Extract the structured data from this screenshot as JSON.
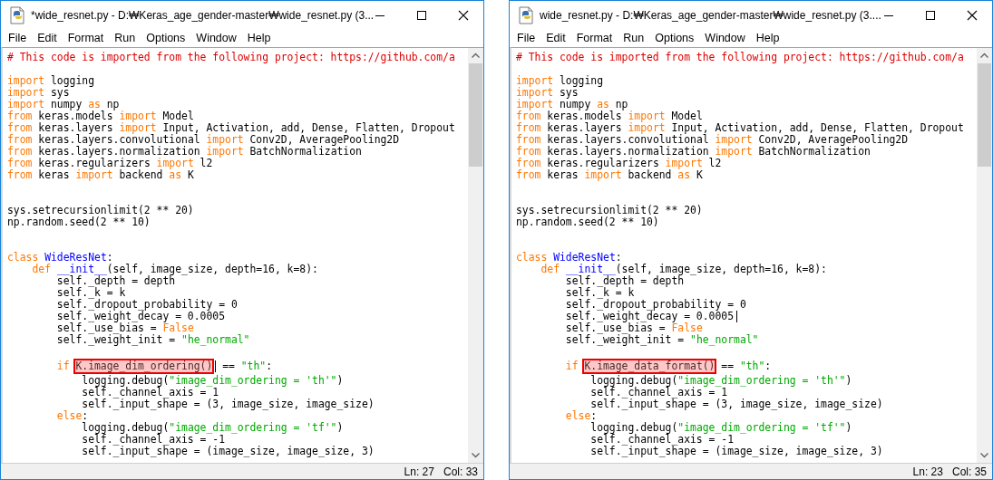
{
  "windows": [
    {
      "title": "*wide_resnet.py - D:₩Keras_age_gender-master₩wide_resnet.py (3...",
      "menu": [
        "File",
        "Edit",
        "Format",
        "Run",
        "Options",
        "Window",
        "Help"
      ],
      "lines": [
        {
          "kind": "code",
          "segments": [
            {
              "t": "# This code is imported from the following project: https://github.com/a",
              "kind": "comment"
            }
          ]
        },
        {
          "kind": "blank"
        },
        {
          "kind": "code",
          "segments": [
            {
              "t": "import",
              "kind": "keyword"
            },
            {
              "t": " logging",
              "kind": "plain"
            }
          ]
        },
        {
          "kind": "code",
          "segments": [
            {
              "t": "import",
              "kind": "keyword"
            },
            {
              "t": " sys",
              "kind": "plain"
            }
          ]
        },
        {
          "kind": "code",
          "segments": [
            {
              "t": "import",
              "kind": "keyword"
            },
            {
              "t": " numpy ",
              "kind": "plain"
            },
            {
              "t": "as",
              "kind": "keyword"
            },
            {
              "t": " np",
              "kind": "plain"
            }
          ]
        },
        {
          "kind": "code",
          "segments": [
            {
              "t": "from",
              "kind": "keyword"
            },
            {
              "t": " keras.models ",
              "kind": "plain"
            },
            {
              "t": "import",
              "kind": "keyword"
            },
            {
              "t": " Model",
              "kind": "plain"
            }
          ]
        },
        {
          "kind": "code",
          "segments": [
            {
              "t": "from",
              "kind": "keyword"
            },
            {
              "t": " keras.layers ",
              "kind": "plain"
            },
            {
              "t": "import",
              "kind": "keyword"
            },
            {
              "t": " Input, Activation, add, Dense, Flatten, Dropout",
              "kind": "plain"
            }
          ]
        },
        {
          "kind": "code",
          "segments": [
            {
              "t": "from",
              "kind": "keyword"
            },
            {
              "t": " keras.layers.convolutional ",
              "kind": "plain"
            },
            {
              "t": "import",
              "kind": "keyword"
            },
            {
              "t": " Conv2D, AveragePooling2D",
              "kind": "plain"
            }
          ]
        },
        {
          "kind": "code",
          "segments": [
            {
              "t": "from",
              "kind": "keyword"
            },
            {
              "t": " keras.layers.normalization ",
              "kind": "plain"
            },
            {
              "t": "import",
              "kind": "keyword"
            },
            {
              "t": " BatchNormalization",
              "kind": "plain"
            }
          ]
        },
        {
          "kind": "code",
          "segments": [
            {
              "t": "from",
              "kind": "keyword"
            },
            {
              "t": " keras.regularizers ",
              "kind": "plain"
            },
            {
              "t": "import",
              "kind": "keyword"
            },
            {
              "t": " l2",
              "kind": "plain"
            }
          ]
        },
        {
          "kind": "code",
          "segments": [
            {
              "t": "from",
              "kind": "keyword"
            },
            {
              "t": " keras ",
              "kind": "plain"
            },
            {
              "t": "import",
              "kind": "keyword"
            },
            {
              "t": " backend ",
              "kind": "plain"
            },
            {
              "t": "as",
              "kind": "keyword"
            },
            {
              "t": " K",
              "kind": "plain"
            }
          ]
        },
        {
          "kind": "blank"
        },
        {
          "kind": "blank"
        },
        {
          "kind": "code",
          "segments": [
            {
              "t": "sys.setrecursionlimit(2 ** 20)",
              "kind": "plain"
            }
          ]
        },
        {
          "kind": "code",
          "segments": [
            {
              "t": "np.random.seed(2 ** 10)",
              "kind": "plain"
            }
          ]
        },
        {
          "kind": "blank"
        },
        {
          "kind": "blank"
        },
        {
          "kind": "code",
          "segments": [
            {
              "t": "class ",
              "kind": "keyword"
            },
            {
              "t": "WideResNet",
              "kind": "definition"
            },
            {
              "t": ":",
              "kind": "plain"
            }
          ]
        },
        {
          "kind": "code",
          "segments": [
            {
              "t": "    def ",
              "kind": "keyword"
            },
            {
              "t": "__init__",
              "kind": "definition"
            },
            {
              "t": "(self, image_size, depth=16, k=8):",
              "kind": "plain"
            }
          ]
        },
        {
          "kind": "code",
          "segments": [
            {
              "t": "        self._depth = depth",
              "kind": "plain"
            }
          ]
        },
        {
          "kind": "code",
          "segments": [
            {
              "t": "        self._k = k",
              "kind": "plain"
            }
          ]
        },
        {
          "kind": "code",
          "segments": [
            {
              "t": "        self._dropout_probability = 0",
              "kind": "plain"
            }
          ]
        },
        {
          "kind": "code",
          "segments": [
            {
              "t": "        self._weight_decay = 0.0005",
              "kind": "plain"
            }
          ]
        },
        {
          "kind": "code",
          "segments": [
            {
              "t": "        self._use_bias = ",
              "kind": "plain"
            },
            {
              "t": "False",
              "kind": "keyword"
            }
          ]
        },
        {
          "kind": "code",
          "segments": [
            {
              "t": "        self._weight_init = ",
              "kind": "plain"
            },
            {
              "t": "\"he_normal\"",
              "kind": "string"
            }
          ]
        },
        {
          "kind": "blank"
        },
        {
          "kind": "code",
          "segments": [
            {
              "t": "        if ",
              "kind": "keyword"
            },
            {
              "t": "K.image_dim_ordering()",
              "kind": "selection",
              "boxed": true,
              "caret": true
            },
            {
              "t": " == ",
              "kind": "plain"
            },
            {
              "t": "\"th\"",
              "kind": "string"
            },
            {
              "t": ":",
              "kind": "plain"
            }
          ]
        },
        {
          "kind": "code",
          "segments": [
            {
              "t": "            logging.debug(",
              "kind": "plain"
            },
            {
              "t": "\"image_dim_ordering = 'th'\"",
              "kind": "string"
            },
            {
              "t": ")",
              "kind": "plain"
            }
          ]
        },
        {
          "kind": "code",
          "segments": [
            {
              "t": "            self._channel_axis = 1",
              "kind": "plain"
            }
          ]
        },
        {
          "kind": "code",
          "segments": [
            {
              "t": "            self._input_shape = (3, image_size, image_size)",
              "kind": "plain"
            }
          ]
        },
        {
          "kind": "code",
          "segments": [
            {
              "t": "        else",
              "kind": "keyword"
            },
            {
              "t": ":",
              "kind": "plain"
            }
          ]
        },
        {
          "kind": "code",
          "segments": [
            {
              "t": "            logging.debug(",
              "kind": "plain"
            },
            {
              "t": "\"image_dim_ordering = 'tf'\"",
              "kind": "string"
            },
            {
              "t": ")",
              "kind": "plain"
            }
          ]
        },
        {
          "kind": "code",
          "segments": [
            {
              "t": "            self._channel_axis = -1",
              "kind": "plain"
            }
          ]
        },
        {
          "kind": "code",
          "segments": [
            {
              "t": "            self._input_shape = (image_size, image_size, 3)",
              "kind": "plain"
            }
          ]
        }
      ],
      "status": [
        "Ln: 27",
        "Col: 33"
      ]
    },
    {
      "title": "wide_resnet.py - D:₩Keras_age_gender-master₩wide_resnet.py (3....",
      "menu": [
        "File",
        "Edit",
        "Format",
        "Run",
        "Options",
        "Window",
        "Help"
      ],
      "lines": [
        {
          "kind": "code",
          "segments": [
            {
              "t": "# This code is imported from the following project: https://github.com/a",
              "kind": "comment"
            }
          ]
        },
        {
          "kind": "blank"
        },
        {
          "kind": "code",
          "segments": [
            {
              "t": "import",
              "kind": "keyword"
            },
            {
              "t": " logging",
              "kind": "plain"
            }
          ]
        },
        {
          "kind": "code",
          "segments": [
            {
              "t": "import",
              "kind": "keyword"
            },
            {
              "t": " sys",
              "kind": "plain"
            }
          ]
        },
        {
          "kind": "code",
          "segments": [
            {
              "t": "import",
              "kind": "keyword"
            },
            {
              "t": " numpy ",
              "kind": "plain"
            },
            {
              "t": "as",
              "kind": "keyword"
            },
            {
              "t": " np",
              "kind": "plain"
            }
          ]
        },
        {
          "kind": "code",
          "segments": [
            {
              "t": "from",
              "kind": "keyword"
            },
            {
              "t": " keras.models ",
              "kind": "plain"
            },
            {
              "t": "import",
              "kind": "keyword"
            },
            {
              "t": " Model",
              "kind": "plain"
            }
          ]
        },
        {
          "kind": "code",
          "segments": [
            {
              "t": "from",
              "kind": "keyword"
            },
            {
              "t": " keras.layers ",
              "kind": "plain"
            },
            {
              "t": "import",
              "kind": "keyword"
            },
            {
              "t": " Input, Activation, add, Dense, Flatten, Dropout",
              "kind": "plain"
            }
          ]
        },
        {
          "kind": "code",
          "segments": [
            {
              "t": "from",
              "kind": "keyword"
            },
            {
              "t": " keras.layers.convolutional ",
              "kind": "plain"
            },
            {
              "t": "import",
              "kind": "keyword"
            },
            {
              "t": " Conv2D, AveragePooling2D",
              "kind": "plain"
            }
          ]
        },
        {
          "kind": "code",
          "segments": [
            {
              "t": "from",
              "kind": "keyword"
            },
            {
              "t": " keras.layers.normalization ",
              "kind": "plain"
            },
            {
              "t": "import",
              "kind": "keyword"
            },
            {
              "t": " BatchNormalization",
              "kind": "plain"
            }
          ]
        },
        {
          "kind": "code",
          "segments": [
            {
              "t": "from",
              "kind": "keyword"
            },
            {
              "t": " keras.regularizers ",
              "kind": "plain"
            },
            {
              "t": "import",
              "kind": "keyword"
            },
            {
              "t": " l2",
              "kind": "plain"
            }
          ]
        },
        {
          "kind": "code",
          "segments": [
            {
              "t": "from",
              "kind": "keyword"
            },
            {
              "t": " keras ",
              "kind": "plain"
            },
            {
              "t": "import",
              "kind": "keyword"
            },
            {
              "t": " backend ",
              "kind": "plain"
            },
            {
              "t": "as",
              "kind": "keyword"
            },
            {
              "t": " K",
              "kind": "plain"
            }
          ]
        },
        {
          "kind": "blank"
        },
        {
          "kind": "blank"
        },
        {
          "kind": "code",
          "segments": [
            {
              "t": "sys.setrecursionlimit(2 ** 20)",
              "kind": "plain"
            }
          ]
        },
        {
          "kind": "code",
          "segments": [
            {
              "t": "np.random.seed(2 ** 10)",
              "kind": "plain"
            }
          ]
        },
        {
          "kind": "blank"
        },
        {
          "kind": "blank"
        },
        {
          "kind": "code",
          "segments": [
            {
              "t": "class ",
              "kind": "keyword"
            },
            {
              "t": "WideResNet",
              "kind": "definition"
            },
            {
              "t": ":",
              "kind": "plain"
            }
          ]
        },
        {
          "kind": "code",
          "segments": [
            {
              "t": "    def ",
              "kind": "keyword"
            },
            {
              "t": "__init__",
              "kind": "definition"
            },
            {
              "t": "(self, image_size, depth=16, k=8):",
              "kind": "plain"
            }
          ]
        },
        {
          "kind": "code",
          "segments": [
            {
              "t": "        self._depth = depth",
              "kind": "plain"
            }
          ]
        },
        {
          "kind": "code",
          "segments": [
            {
              "t": "        self._k = k",
              "kind": "plain"
            }
          ]
        },
        {
          "kind": "code",
          "segments": [
            {
              "t": "        self._dropout_probability = 0",
              "kind": "plain"
            }
          ]
        },
        {
          "kind": "code",
          "segments": [
            {
              "t": "        self._weight_decay = 0.0005",
              "kind": "plain",
              "caret": true
            }
          ]
        },
        {
          "kind": "code",
          "segments": [
            {
              "t": "        self._use_bias = ",
              "kind": "plain"
            },
            {
              "t": "False",
              "kind": "keyword"
            }
          ]
        },
        {
          "kind": "code",
          "segments": [
            {
              "t": "        self._weight_init = ",
              "kind": "plain"
            },
            {
              "t": "\"he_normal\"",
              "kind": "string"
            }
          ]
        },
        {
          "kind": "blank"
        },
        {
          "kind": "code",
          "segments": [
            {
              "t": "        if ",
              "kind": "keyword"
            },
            {
              "t": "K.image_data_format()",
              "kind": "selection",
              "boxed": true
            },
            {
              "t": " == ",
              "kind": "plain"
            },
            {
              "t": "\"th\"",
              "kind": "string"
            },
            {
              "t": ":",
              "kind": "plain"
            }
          ]
        },
        {
          "kind": "code",
          "segments": [
            {
              "t": "            logging.debug(",
              "kind": "plain"
            },
            {
              "t": "\"image_dim_ordering = 'th'\"",
              "kind": "string"
            },
            {
              "t": ")",
              "kind": "plain"
            }
          ]
        },
        {
          "kind": "code",
          "segments": [
            {
              "t": "            self._channel_axis = 1",
              "kind": "plain"
            }
          ]
        },
        {
          "kind": "code",
          "segments": [
            {
              "t": "            self._input_shape = (3, image_size, image_size)",
              "kind": "plain"
            }
          ]
        },
        {
          "kind": "code",
          "segments": [
            {
              "t": "        else",
              "kind": "keyword"
            },
            {
              "t": ":",
              "kind": "plain"
            }
          ]
        },
        {
          "kind": "code",
          "segments": [
            {
              "t": "            logging.debug(",
              "kind": "plain"
            },
            {
              "t": "\"image_dim_ordering = 'tf'\"",
              "kind": "string"
            },
            {
              "t": ")",
              "kind": "plain"
            }
          ]
        },
        {
          "kind": "code",
          "segments": [
            {
              "t": "            self._channel_axis = -1",
              "kind": "plain"
            }
          ]
        },
        {
          "kind": "code",
          "segments": [
            {
              "t": "            self._input_shape = (image_size, image_size, 3)",
              "kind": "plain"
            }
          ]
        }
      ],
      "status": [
        "Ln: 23",
        "Col: 35"
      ]
    }
  ]
}
